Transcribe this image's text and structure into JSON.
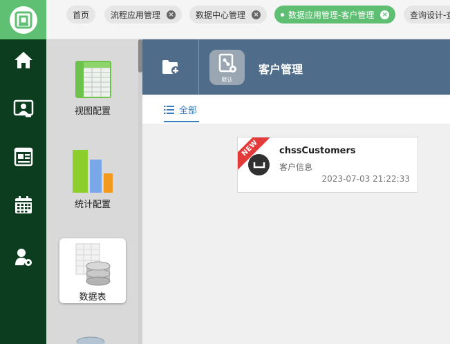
{
  "tabs": [
    {
      "label": "首页",
      "closable": false,
      "active": false
    },
    {
      "label": "流程应用管理",
      "closable": true,
      "active": false
    },
    {
      "label": "数据中心管理",
      "closable": true,
      "active": false
    },
    {
      "label": "数据应用管理-客户管理",
      "closable": true,
      "active": true
    },
    {
      "label": "查询设计-查",
      "closable": false,
      "active": false
    }
  ],
  "tab_close_glyph": "×",
  "rail": {
    "items": [
      {
        "name": "home-icon"
      },
      {
        "name": "user-card-icon"
      },
      {
        "name": "news-icon"
      },
      {
        "name": "calendar-icon"
      },
      {
        "name": "user-settings-icon"
      }
    ]
  },
  "sidebar": {
    "items": [
      {
        "label": "视图配置",
        "icon": "spreadsheet-icon"
      },
      {
        "label": "统计配置",
        "icon": "bar-chart-icon"
      },
      {
        "label": "数据表",
        "icon": "database-table-icon",
        "selected": true
      }
    ]
  },
  "header": {
    "badge_label": "默认",
    "title": "客户管理"
  },
  "filter": {
    "all_label": "全部"
  },
  "cards": [
    {
      "ribbon": "NEW",
      "title": "chssCustomers",
      "subtitle": "客户信息",
      "timestamp": "2023-07-03 21:22:33"
    }
  ],
  "colors": {
    "rail_bg": "#0d3d1f",
    "brand_green": "#5ebf72",
    "header_bg": "#4f6d8a",
    "link_blue": "#3a7bbf",
    "ribbon_red": "#e33a3a"
  }
}
